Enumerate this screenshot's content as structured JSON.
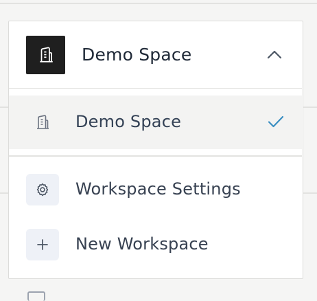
{
  "workspace_switcher": {
    "current_workspace": "Demo Space",
    "avatar_icon": "building-icon",
    "toggle_icon": "chevron-up-icon",
    "expanded": true
  },
  "menu": {
    "workspaces": [
      {
        "label": "Demo Space",
        "icon": "building-icon",
        "selected": true,
        "selected_icon": "checkmark-icon"
      }
    ],
    "actions": [
      {
        "label": "Workspace Settings",
        "icon": "gear-icon"
      },
      {
        "label": "New Workspace",
        "icon": "plus-icon"
      }
    ]
  },
  "colors": {
    "avatar_bg": "#1f1f1f",
    "check": "#3b8fc2",
    "selected_row_bg": "#f3f3f2",
    "icon_box_bg": "#eef1f7"
  }
}
